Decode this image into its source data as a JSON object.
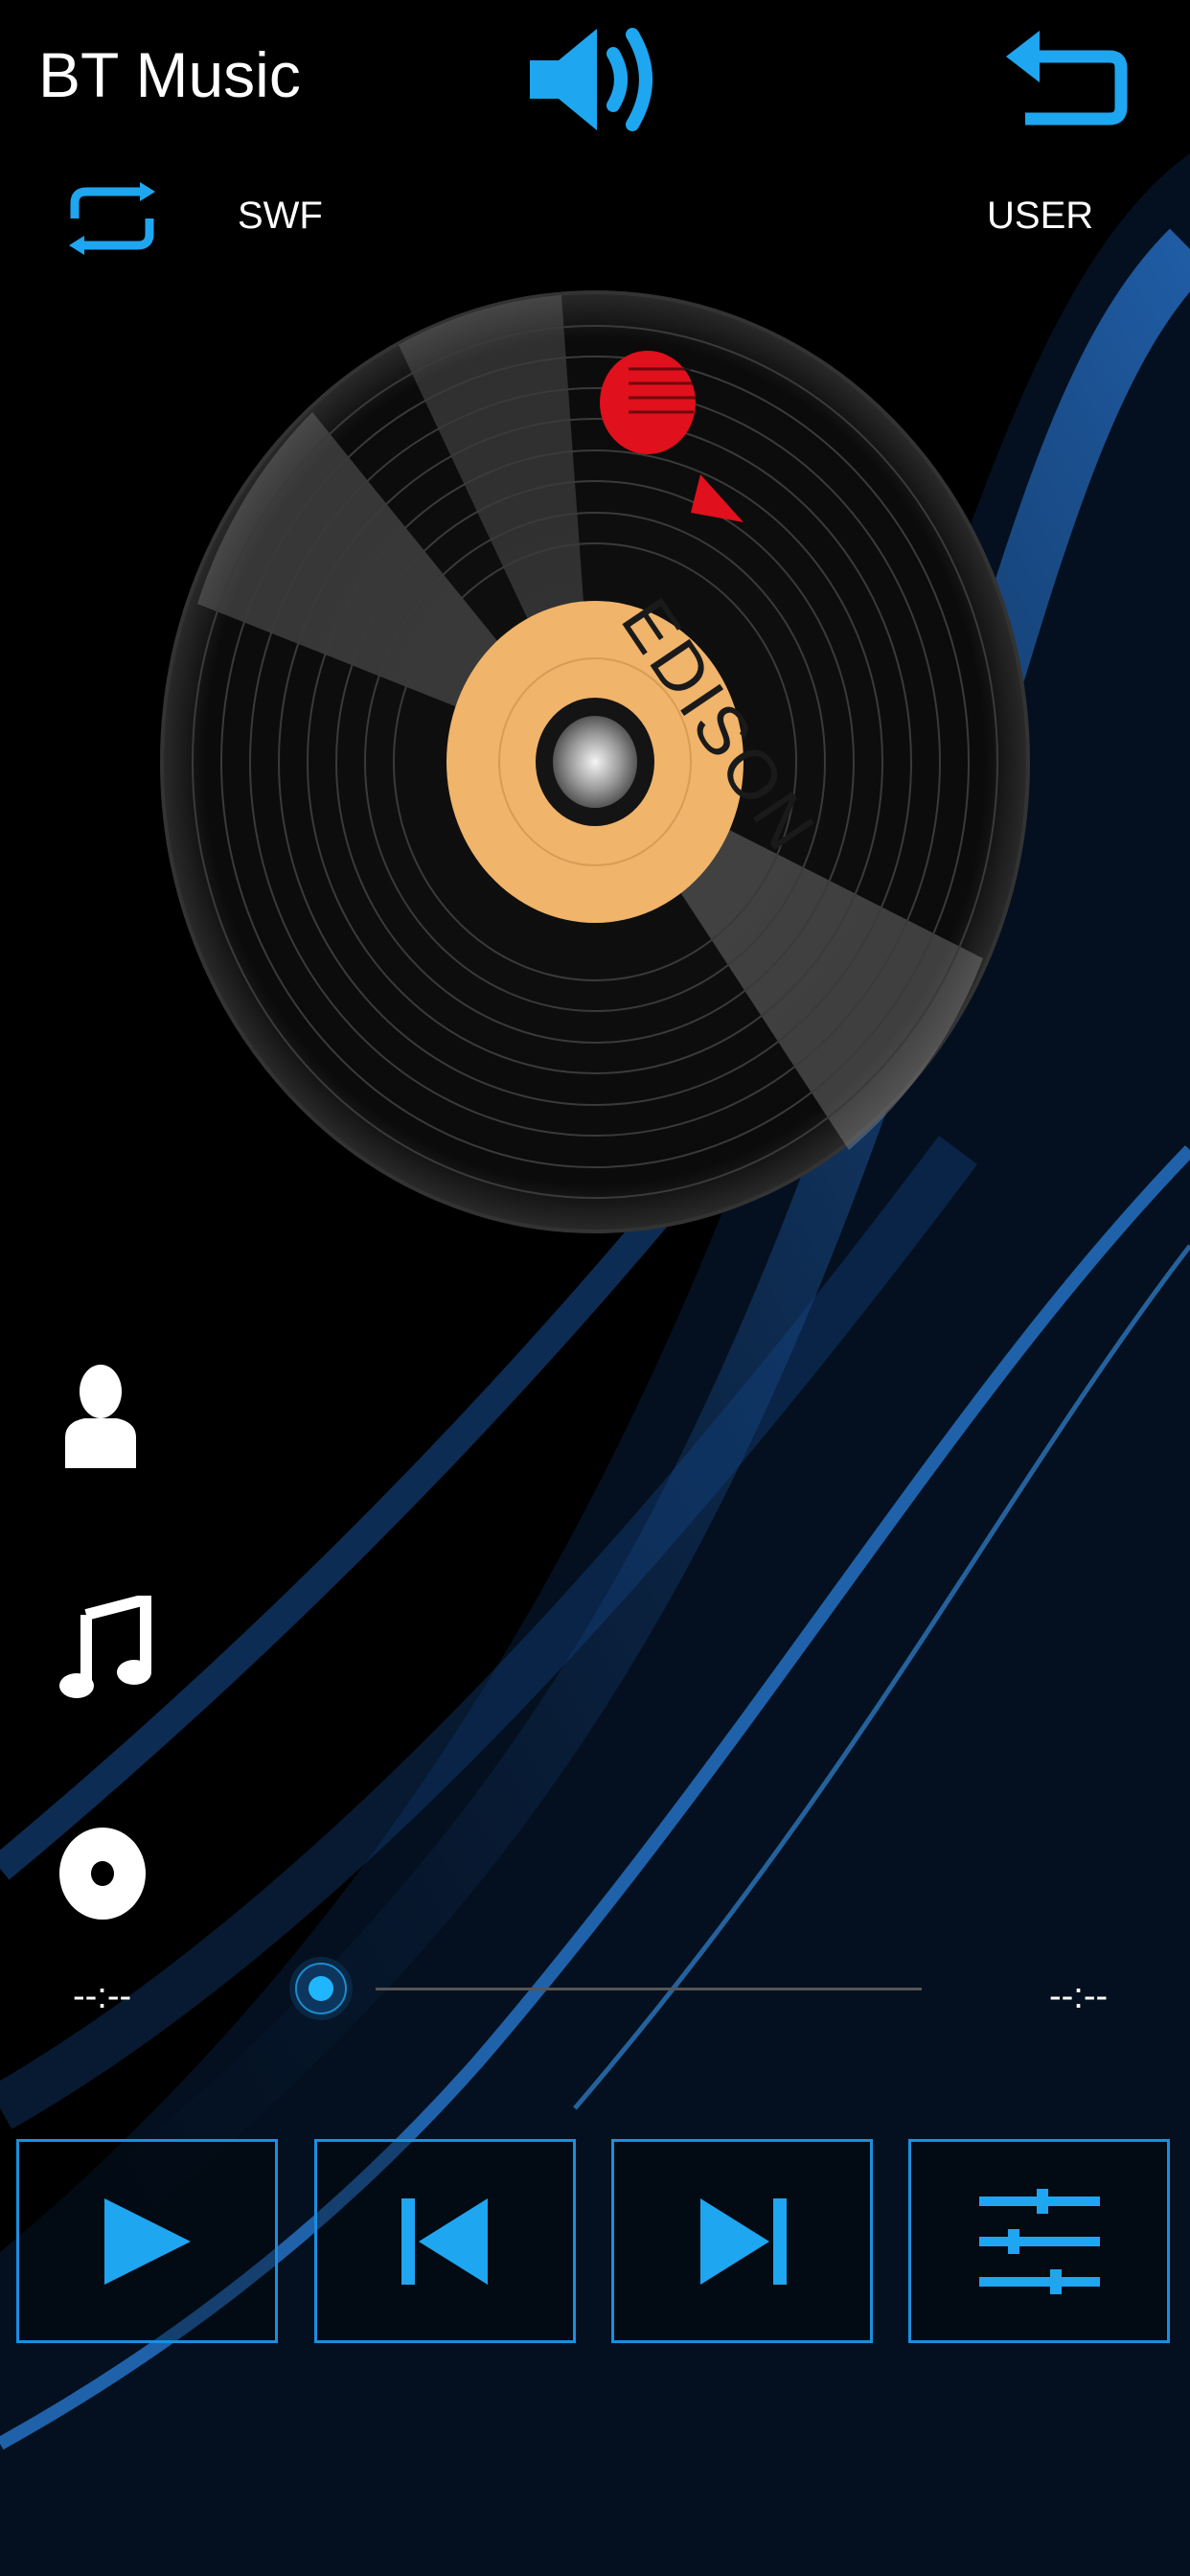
{
  "header": {
    "title": "BT Music",
    "volume_icon": "volume-icon",
    "back_icon": "back-icon"
  },
  "subheader": {
    "repeat_icon": "repeat-icon",
    "eq_mode": "SWF",
    "user_label": "USER"
  },
  "disc": {
    "brand_logo_text": "EDISON"
  },
  "info_icons": [
    "artist-icon",
    "song-icon",
    "album-icon"
  ],
  "progress": {
    "current_time": "--:--",
    "total_time": "--:--",
    "position": 0
  },
  "controls": [
    {
      "name": "play-button",
      "icon": "play-icon"
    },
    {
      "name": "previous-button",
      "icon": "skip-previous-icon"
    },
    {
      "name": "next-button",
      "icon": "skip-next-icon"
    },
    {
      "name": "equalizer-button",
      "icon": "equalizer-icon"
    }
  ],
  "colors": {
    "accent": "#1fa6f0",
    "background": "#000000",
    "label_center": "#f0b46a"
  }
}
